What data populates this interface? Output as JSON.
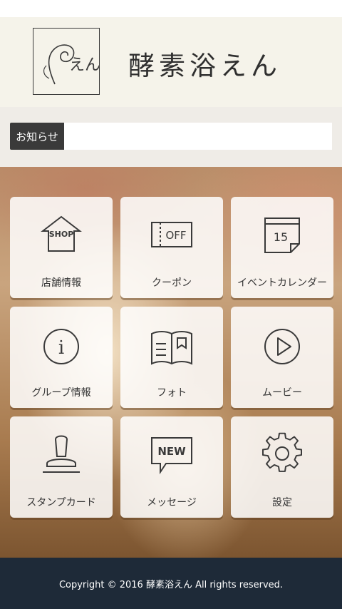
{
  "header": {
    "brand_name": "酵素浴えん",
    "logo_text": "えん"
  },
  "news": {
    "label": "お知らせ",
    "content": ""
  },
  "menu": {
    "items": [
      {
        "label": "店舗情報",
        "icon": "shop-icon",
        "icon_text": "SHOP"
      },
      {
        "label": "クーポン",
        "icon": "coupon-icon",
        "icon_text": "OFF"
      },
      {
        "label": "イベントカレンダー",
        "icon": "calendar-icon",
        "icon_text": "15"
      },
      {
        "label": "グループ情報",
        "icon": "info-icon",
        "icon_text": "i"
      },
      {
        "label": "フォト",
        "icon": "photo-book-icon"
      },
      {
        "label": "ムービー",
        "icon": "play-icon"
      },
      {
        "label": "スタンプカード",
        "icon": "stamp-icon"
      },
      {
        "label": "メッセージ",
        "icon": "new-message-icon",
        "icon_text": "NEW"
      },
      {
        "label": "設定",
        "icon": "gear-icon"
      }
    ]
  },
  "footer": {
    "copyright": "Copyright © 2016 酵素浴えん All rights reserved."
  }
}
